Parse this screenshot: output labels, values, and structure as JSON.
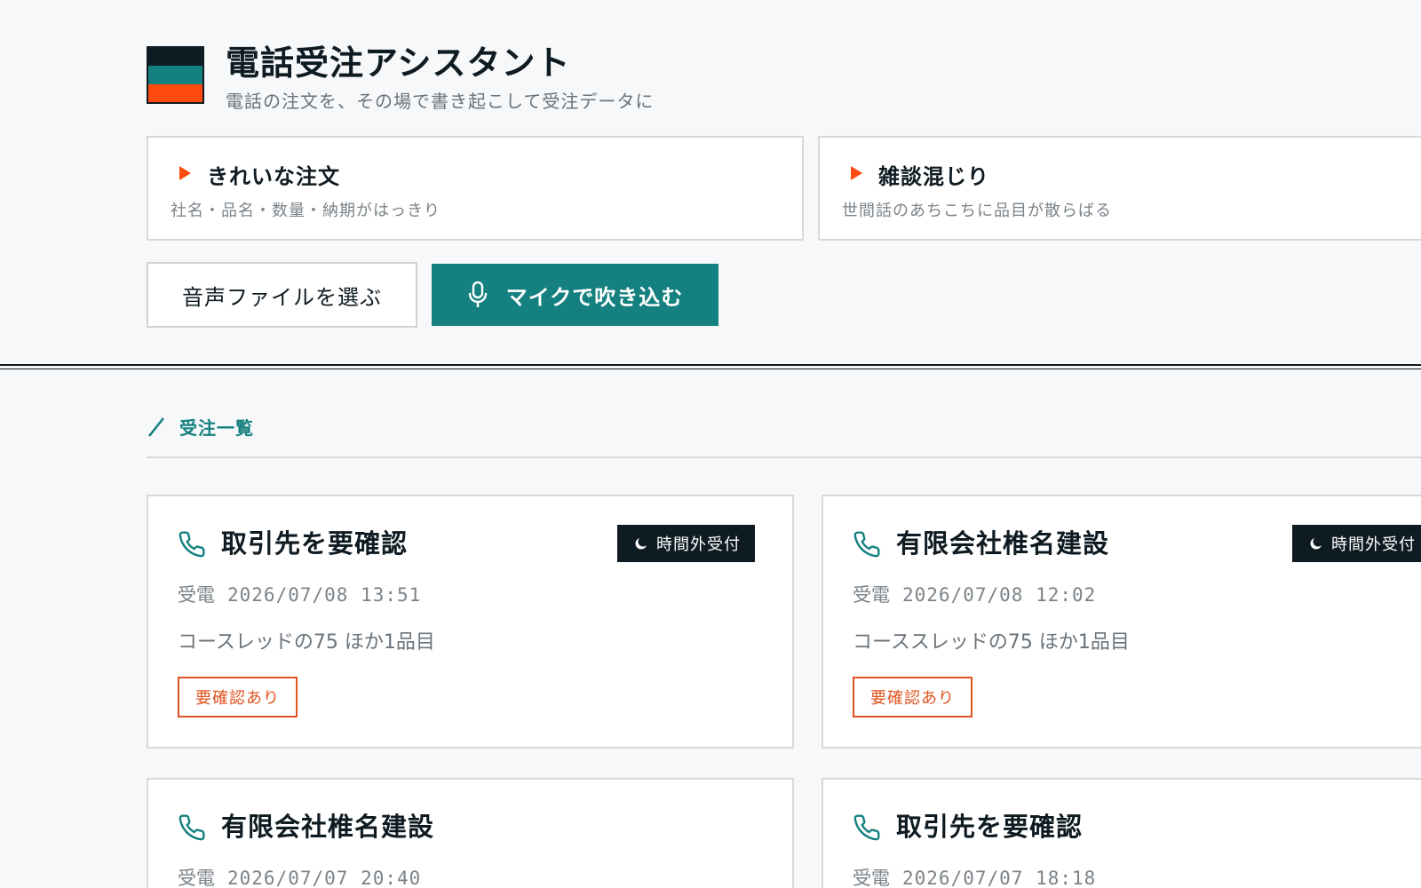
{
  "app": {
    "title": "電話受注アシスタント",
    "subtitle": "電話の注文を、その場で書き起こして受注データに"
  },
  "samples": [
    {
      "title": "きれいな注文",
      "desc": "社名・品名・数量・納期がはっきり"
    },
    {
      "title": "雑談混じり",
      "desc": "世間話のあちこちに品目が散らばる"
    }
  ],
  "actions": {
    "file_label": "音声ファイルを選ぶ",
    "mic_label": "マイクで吹き込む"
  },
  "section": {
    "title": "受注一覧"
  },
  "orders": [
    {
      "company": "取引先を要確認",
      "recv_label": "受電",
      "datetime": "2026/07/08 13:51",
      "summary": "コースレッドの75 ほか1品目",
      "badge": "時間外受付",
      "warning": "要確認あり"
    },
    {
      "company": "有限会社椎名建設",
      "recv_label": "受電",
      "datetime": "2026/07/08 12:02",
      "summary": "コーススレッドの75 ほか1品目",
      "badge": "時間外受付",
      "warning": "要確認あり"
    },
    {
      "company": "有限会社椎名建設",
      "recv_label": "受電",
      "datetime": "2026/07/07 20:40"
    },
    {
      "company": "取引先を要確認",
      "recv_label": "受電",
      "datetime": "2026/07/07 18:18"
    }
  ],
  "colors": {
    "navy": "#0f1b22",
    "teal": "#14807f",
    "orange": "#ff4a0f",
    "warn": "#e0531f"
  },
  "icons": {
    "phone": "phone-icon",
    "moon": "moon-icon",
    "mic": "microphone-icon",
    "play": "play-triangle-icon",
    "slash": "slash-icon"
  }
}
